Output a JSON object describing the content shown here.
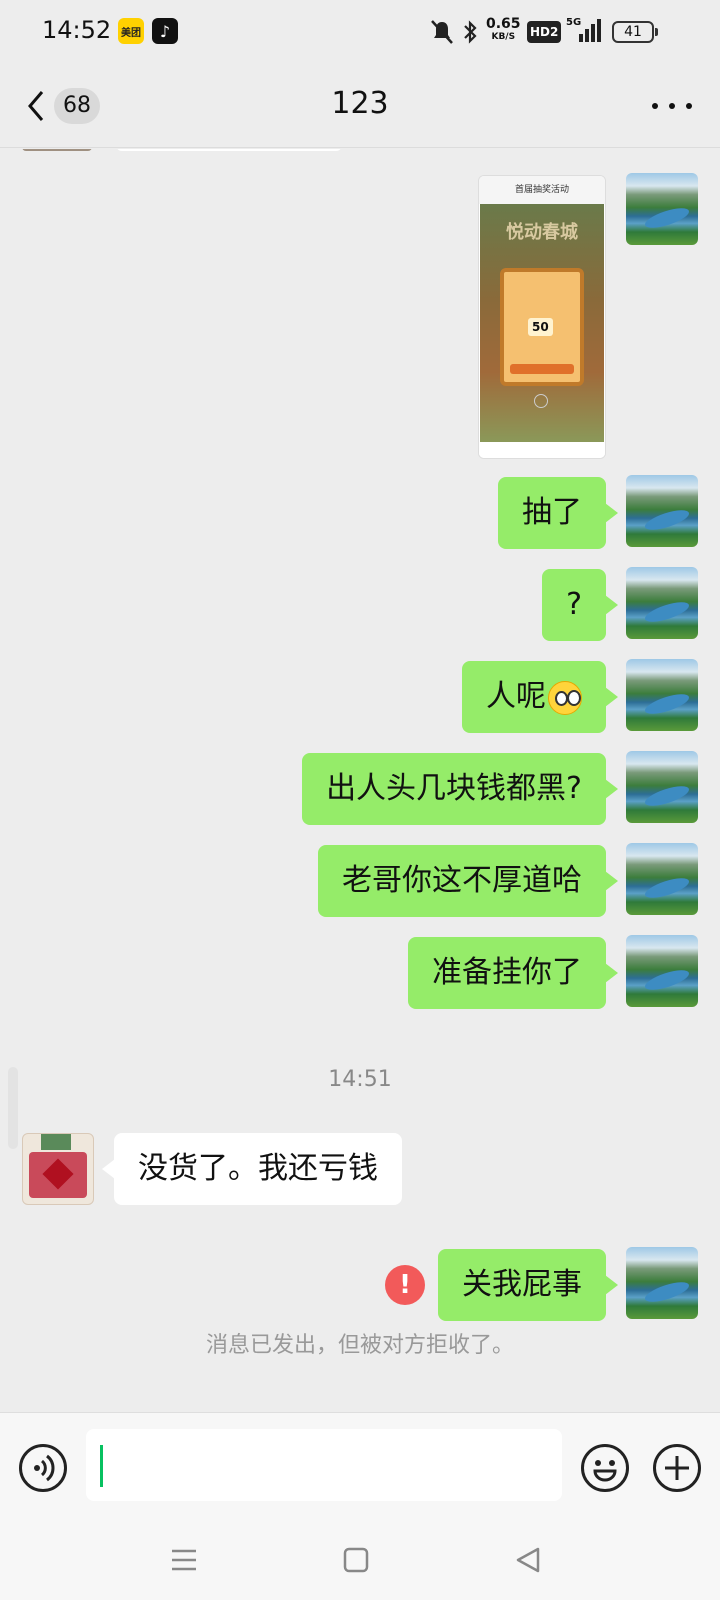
{
  "status_bar": {
    "time": "14:52",
    "app_meituan": "美团",
    "network_speed": "0.65",
    "network_unit": "KB/S",
    "hd_label": "HD2",
    "signal_label": "5G",
    "battery": "41"
  },
  "header": {
    "unread_count": "68",
    "title": "123"
  },
  "messages": [
    {
      "from": "me",
      "type": "image",
      "image_title": "悦动春城",
      "image_amount": "50",
      "image_top_text": "首届抽奖活动"
    },
    {
      "from": "me",
      "type": "text",
      "text": "抽了"
    },
    {
      "from": "me",
      "type": "text",
      "text": "?"
    },
    {
      "from": "me",
      "type": "text",
      "text": "人呢"
    },
    {
      "from": "me",
      "type": "text",
      "text": "出人头几块钱都黑?"
    },
    {
      "from": "me",
      "type": "text",
      "text": "老哥你这不厚道哈"
    },
    {
      "from": "me",
      "type": "text",
      "text": "准备挂你了"
    },
    {
      "from": "other",
      "type": "text",
      "text": "没货了。我还亏钱"
    },
    {
      "from": "me",
      "type": "text",
      "text": "关我屁事",
      "failed": true
    }
  ],
  "timestamp": "14:51",
  "error_mark": "!",
  "system_note": "消息已发出，但被对方拒收了。",
  "input": {
    "value": ""
  },
  "icons": {
    "back": "chevron-left-icon",
    "more": "more-dots-icon",
    "voice": "voice-icon",
    "emoji": "emoji-icon",
    "plus": "plus-icon",
    "error": "error-icon",
    "nav_menu": "menu-icon",
    "nav_home": "home-icon",
    "nav_back": "triangle-back-icon"
  },
  "colors": {
    "my_bubble": "#95ec69",
    "other_bubble": "#ffffff",
    "error": "#f25a5a",
    "caret": "#07c160"
  }
}
